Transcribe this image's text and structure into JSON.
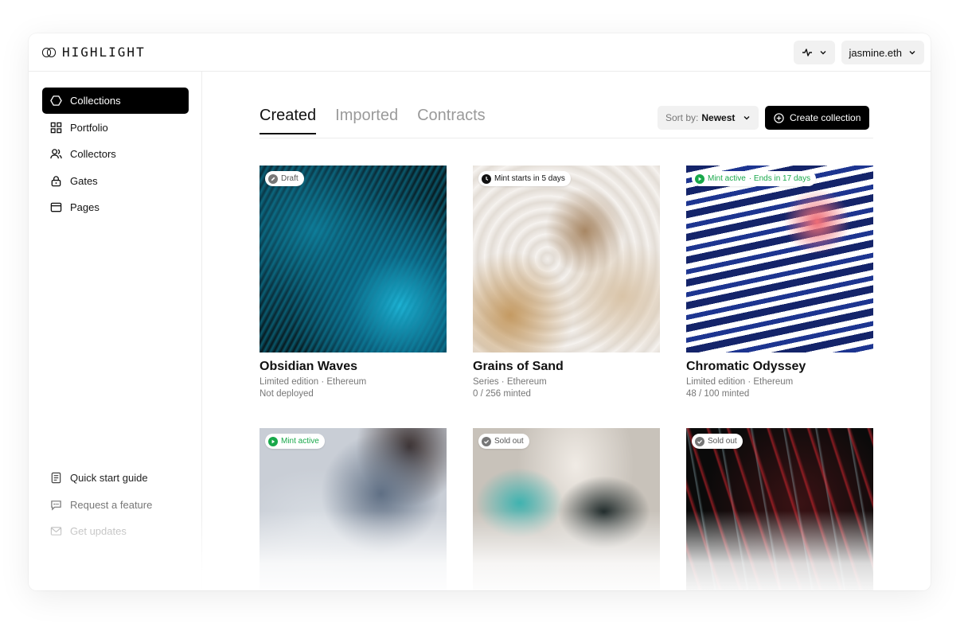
{
  "brand": {
    "name": "HIGHLIGHT"
  },
  "topbar": {
    "activity_icon": "activity-icon",
    "account": "jasmine.eth"
  },
  "sidebar": {
    "items": [
      {
        "label": "Collections",
        "icon": "hexagon-icon",
        "active": true
      },
      {
        "label": "Portfolio",
        "icon": "grid-icon"
      },
      {
        "label": "Collectors",
        "icon": "users-icon"
      },
      {
        "label": "Gates",
        "icon": "lock-icon"
      },
      {
        "label": "Pages",
        "icon": "page-icon"
      }
    ],
    "bottom": [
      {
        "label": "Quick start guide",
        "icon": "document-icon"
      },
      {
        "label": "Request a feature",
        "icon": "chat-icon"
      },
      {
        "label": "Get updates",
        "icon": "mail-icon"
      }
    ]
  },
  "main": {
    "tabs": [
      {
        "label": "Created",
        "active": true
      },
      {
        "label": "Imported"
      },
      {
        "label": "Contracts"
      }
    ],
    "sort": {
      "label": "Sort by:",
      "value": "Newest"
    },
    "create_label": "Create collection",
    "cards": [
      {
        "title": "Obsidian Waves",
        "type": "Limited edition",
        "chain": "Ethereum",
        "status": "Not deployed",
        "badge": {
          "text": "Draft",
          "icon": "pencil-icon"
        }
      },
      {
        "title": "Grains of Sand",
        "type": "Series",
        "chain": "Ethereum",
        "status": "0 / 256 minted",
        "badge": {
          "text": "Mint starts in 5 days",
          "icon": "clock-icon"
        }
      },
      {
        "title": "Chromatic Odyssey",
        "type": "Limited edition",
        "chain": "Ethereum",
        "status": "48 / 100 minted",
        "badge": {
          "text": "Mint active",
          "extra": " · Ends in 17 days",
          "icon": "play-icon"
        }
      },
      {
        "badge": {
          "text": "Mint active",
          "icon": "play-icon"
        }
      },
      {
        "badge": {
          "text": "Sold out",
          "icon": "check-icon"
        }
      },
      {
        "badge": {
          "text": "Sold out",
          "icon": "check-icon"
        }
      }
    ]
  },
  "colors": {
    "accent": "#000000",
    "active_green": "#18a84a",
    "muted": "#777777"
  }
}
